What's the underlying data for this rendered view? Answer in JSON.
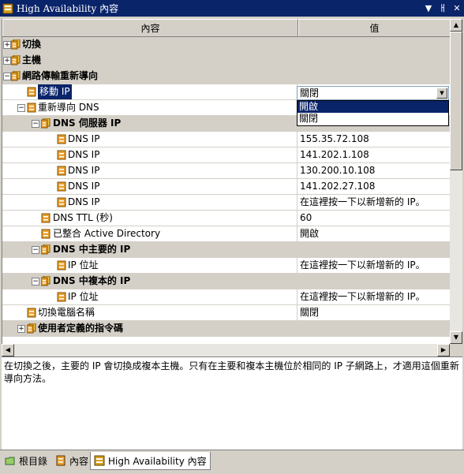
{
  "window": {
    "title": "High Availability 內容"
  },
  "grid": {
    "columns": [
      "內容",
      "值"
    ],
    "rows": [
      {
        "label": "切換",
        "value": "",
        "kind": "cat",
        "level": 0,
        "expander": "+"
      },
      {
        "label": "主機",
        "value": "",
        "kind": "cat",
        "level": 0,
        "expander": "+"
      },
      {
        "label": "網路傳輸重新導向",
        "value": "",
        "kind": "cat",
        "level": 0,
        "expander": "-"
      },
      {
        "label": "移動 IP",
        "value": "",
        "kind": "sel",
        "level": 1,
        "expander": ""
      },
      {
        "label": "重新導向 DNS",
        "value": "",
        "kind": "item",
        "level": 1,
        "expander": "-"
      },
      {
        "label": "DNS 伺服器 IP",
        "value": "",
        "kind": "cat",
        "level": 2,
        "expander": "-"
      },
      {
        "label": "DNS IP",
        "value": "155.35.72.108",
        "kind": "item",
        "level": 3,
        "expander": ""
      },
      {
        "label": "DNS IP",
        "value": "141.202.1.108",
        "kind": "item",
        "level": 3,
        "expander": ""
      },
      {
        "label": "DNS IP",
        "value": "130.200.10.108",
        "kind": "item",
        "level": 3,
        "expander": ""
      },
      {
        "label": "DNS IP",
        "value": "141.202.27.108",
        "kind": "item",
        "level": 3,
        "expander": ""
      },
      {
        "label": "DNS IP",
        "value": "在這裡按一下以新增新的 IP。",
        "kind": "item",
        "level": 3,
        "expander": ""
      },
      {
        "label": "DNS TTL (秒)",
        "value": "60",
        "kind": "item",
        "level": 2,
        "expander": ""
      },
      {
        "label": "已整合 Active Directory",
        "value": "開啟",
        "kind": "item",
        "level": 2,
        "expander": ""
      },
      {
        "label": "DNS 中主要的 IP",
        "value": "",
        "kind": "cat",
        "level": 2,
        "expander": "-"
      },
      {
        "label": "IP 位址",
        "value": "在這裡按一下以新增新的 IP。",
        "kind": "item",
        "level": 3,
        "expander": ""
      },
      {
        "label": "DNS 中複本的 IP",
        "value": "",
        "kind": "cat",
        "level": 2,
        "expander": "-"
      },
      {
        "label": "IP 位址",
        "value": "在這裡按一下以新增新的 IP。",
        "kind": "item",
        "level": 3,
        "expander": ""
      },
      {
        "label": "切換電腦名稱",
        "value": "關閉",
        "kind": "item",
        "level": 1,
        "expander": ""
      },
      {
        "label": "使用者定義的指令碼",
        "value": "",
        "kind": "cat",
        "level": 1,
        "expander": "+"
      }
    ]
  },
  "dropdown": {
    "value": "關閉",
    "options": [
      "開啟",
      "關閉"
    ],
    "highlighted_option": "開啟"
  },
  "description": "在切換之後，主要的 IP 會切換成複本主機。只有在主要和複本主機位於相同的 IP 子網路上，才適用這個重新導向方法。",
  "tabs": [
    "根目錄",
    "內容",
    "High Availability 內容"
  ],
  "colors": {
    "titlebar": "#0a246a",
    "selection": "#0a246a",
    "face": "#d4d0c8",
    "icon": "#e8a030"
  }
}
